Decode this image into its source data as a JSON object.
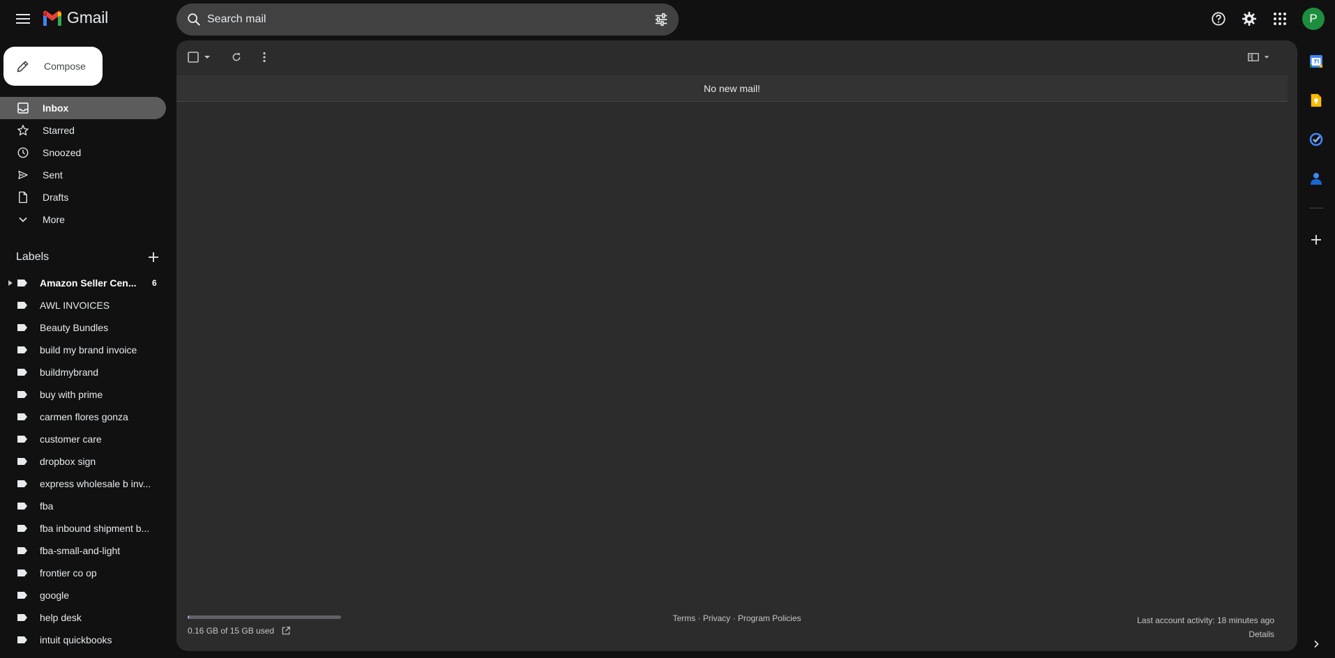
{
  "app": {
    "name": "Gmail"
  },
  "search": {
    "placeholder": "Search mail"
  },
  "account": {
    "avatar_letter": "P"
  },
  "compose": {
    "label": "Compose"
  },
  "nav": {
    "items": [
      {
        "label": "Inbox",
        "icon": "inbox-icon",
        "active": true
      },
      {
        "label": "Starred",
        "icon": "star-icon"
      },
      {
        "label": "Snoozed",
        "icon": "clock-icon"
      },
      {
        "label": "Sent",
        "icon": "send-icon"
      },
      {
        "label": "Drafts",
        "icon": "draft-icon"
      },
      {
        "label": "More",
        "icon": "chevron-down-icon"
      }
    ]
  },
  "labels": {
    "title": "Labels",
    "items": [
      {
        "label": "Amazon Seller Cen...",
        "count": "6",
        "bold": true,
        "expandable": true
      },
      {
        "label": "AWL INVOICES"
      },
      {
        "label": "Beauty Bundles"
      },
      {
        "label": "build my brand invoice"
      },
      {
        "label": "buildmybrand"
      },
      {
        "label": "buy with prime"
      },
      {
        "label": "carmen flores gonza"
      },
      {
        "label": "customer care"
      },
      {
        "label": "dropbox sign"
      },
      {
        "label": "express wholesale b inv..."
      },
      {
        "label": "fba"
      },
      {
        "label": "fba inbound shipment b..."
      },
      {
        "label": "fba-small-and-light"
      },
      {
        "label": "frontier co op"
      },
      {
        "label": "google"
      },
      {
        "label": "help desk"
      },
      {
        "label": "intuit quickbooks"
      }
    ]
  },
  "main": {
    "empty_message": "No new mail!"
  },
  "footer": {
    "storage_text": "0.16 GB of 15 GB used",
    "storage_fraction": 0.01,
    "links": [
      "Terms",
      "Privacy",
      "Program Policies"
    ],
    "link_separator": " · ",
    "last_activity": "Last account activity: 18 minutes ago",
    "details": "Details"
  },
  "colors": {
    "background": "#111111",
    "panel": "#2c2c2c",
    "active_nav": "#5c5c5c",
    "avatar": "#1e8e3e",
    "gmail_red": "#ea4335"
  }
}
